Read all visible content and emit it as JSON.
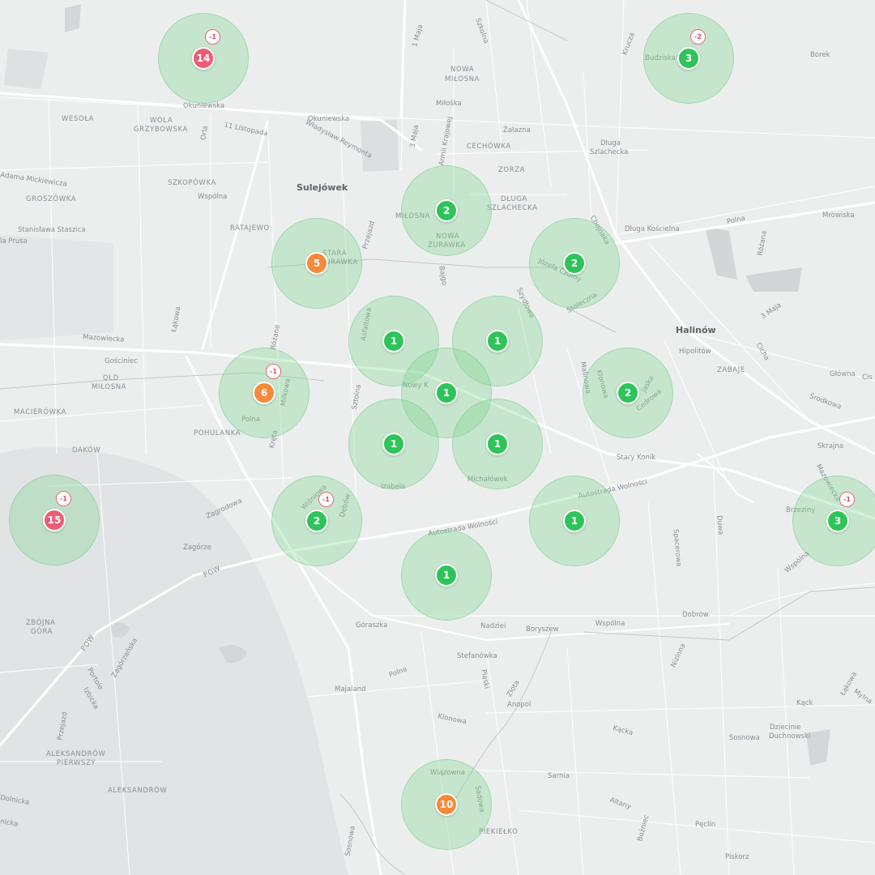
{
  "colors": {
    "green": "#2fc45a",
    "orange": "#f58a3a",
    "red": "#ec5d74",
    "halo": "rgba(120,214,140,0.33)"
  },
  "labels": {
    "okuniewska1": "Okuniewska",
    "okuniewska2": "Okuniewska",
    "wesola": "WESOŁA",
    "wola": "WOLA",
    "grzybowska": "GRZYBOWSKA",
    "orla": "Orla",
    "listopada": "11 Listopada",
    "reymonta": "Władysław Reymonta",
    "maja1": "1 Maja",
    "szkolna": "Szkolna",
    "nowa_milosna": "NOWA",
    "nowa_milosna2": "MIŁOSNA",
    "milosna_street": "Miłośka",
    "maja3": "3 Maja",
    "armii": "Armii Krajowej",
    "cechowka": "CECHÓWKA",
    "zalazna": "Żalazna",
    "dluga1": "Długa",
    "dluga2": "Szlachecka",
    "krucza": "Krucza",
    "borek": "Borek",
    "budziska": "Budziska",
    "mickiewicza": "Adama Mickiewicza",
    "groszowka": "GROSZÓWKA",
    "szkopowka": "SZKOPÓWKA",
    "wspolna1": "Wspólna",
    "sulejowek": "Sulejówek",
    "staszica": "Stanisława Staszica",
    "prusa": "la Prusa",
    "ratajewo": "RATAJEWO",
    "zorza": "ZORZA",
    "dluga_szl1": "DŁUGA",
    "dluga_szl2": "SZLACHECKA",
    "milosna_d": "MIŁOSNA",
    "nowa_zur1": "NOWA",
    "nowa_zur2": "ŻURAWKA",
    "przejazd": "Przejazd",
    "dluga_koscielna": "Długa Kościelna",
    "polna1": "Polna",
    "rozana1": "Różana",
    "mrowiska": "Mrowiska",
    "stara1": "STARA",
    "stara2": "ŻURAWKA",
    "bajgo": "Bajgo",
    "chojnaka": "Chojnaka",
    "jozefa": "Józefa Czumy",
    "stoleczna": "Stołeczna",
    "maja3b": "3 Maja",
    "halinow": "Halinów",
    "mazowiecka": "Mazowiecka",
    "lakowa": "Łąkowa",
    "asfaltowa": "Asfaltowa",
    "szydlowa": "Szydłowa",
    "cicha": "Cicha",
    "hipolitow": "Hipolitów",
    "zabaje": "ZABAJE",
    "glowna": "Główna",
    "cis": "Cis",
    "goscniec": "Gościniec",
    "old_milosna1": "OLD",
    "old_milosna2": "MIŁOSNA",
    "rozane2": "Różane",
    "milkowa": "Miłkowa",
    "nowy_k": "Nowy K",
    "malinowa": "Malinowa",
    "klonowa": "Klonowa",
    "jaska": "jaska",
    "cedrowa": "Cedrowa",
    "srodkowa": "Środkowa",
    "maciorowka": "MACIERÓWKA",
    "polna2": "Polna",
    "pohulanka": "POHULANKA",
    "kreta": "Kręta",
    "sztolna": "Sztolna",
    "skrajna": "Skrajna",
    "stary_konik": "Stary Konik",
    "dakow": "DAKÓW",
    "izabela": "Izabela",
    "michalowek": "Michałówek",
    "autostrada1": "Autostrada Wolności",
    "mazowiecka2": "Mazowiecka",
    "zagrodowa": "Zagrodowa",
    "wisniowa": "Wiśniowa",
    "debow": "Dębów",
    "brzeziny": "Brzeziny",
    "zagorze": "Zagórze",
    "autostrada2": "Autostrada Wolności",
    "duwa": "Duwa",
    "spacerowa": "Spacerowa",
    "wspolna2": "Wspólna",
    "pow1": "POW",
    "zbojna1": "ZBÓJNA",
    "zbojna2": "GÓRA",
    "goraszka": "Góraszka",
    "nadziei": "Nadziei",
    "boryszew": "Boryszew",
    "wspolna3": "Wspólna",
    "dobrow": "Dobrów",
    "pow2": "POW",
    "zagorzanska": "Zagórzańska",
    "stefanowka": "Stefanówka",
    "polna3": "Polna",
    "piaski": "Piaski",
    "portole": "Portole",
    "izbicka": "Izbicka",
    "majaland": "Majaland",
    "zlota": "Złota",
    "anopol": "Anopol",
    "nizinna": "Nizinna",
    "kack": "Kąck",
    "lakowa2": "Łąkowa",
    "mylna": "Mylna",
    "przejazd2": "Przejazd",
    "klonowa2": "Klonowa",
    "kacka": "Kącka",
    "sosnowa1": "Sosnowa",
    "dziecinie1": "Dziecinie",
    "dziecinie2": "Duchnowski",
    "aleks1": "ALEKSANDRÓW",
    "aleks2": "PIERWSZY",
    "aleks3": "ALEKSANDRÓW",
    "sarnia": "Sarnia",
    "altany": "Altany",
    "wiazowna": "Wiązowna",
    "sadowa": "Sadowa",
    "boznicka": "Bożniec",
    "peclin": "Pęclin",
    "piekielko": "PIEKIEŁKO",
    "piskorz": "Piskorz",
    "sosnowa2": "Sosnowa",
    "dolnicka": "Dolnicka",
    "nicka": "nicka"
  },
  "clusters": [
    {
      "count": "14",
      "color": "red",
      "badge": "-1"
    },
    {
      "count": "3",
      "color": "green",
      "badge": "-2"
    },
    {
      "count": "2",
      "color": "green",
      "badge": ""
    },
    {
      "count": "5",
      "color": "orange",
      "badge": ""
    },
    {
      "count": "2",
      "color": "green",
      "badge": ""
    },
    {
      "count": "1",
      "color": "green",
      "badge": ""
    },
    {
      "count": "1",
      "color": "green",
      "badge": ""
    },
    {
      "count": "1",
      "color": "green",
      "badge": ""
    },
    {
      "count": "6",
      "color": "orange",
      "badge": "-1"
    },
    {
      "count": "2",
      "color": "green",
      "badge": ""
    },
    {
      "count": "1",
      "color": "green",
      "badge": ""
    },
    {
      "count": "1",
      "color": "green",
      "badge": ""
    },
    {
      "count": "15",
      "color": "red",
      "badge": "-1"
    },
    {
      "count": "2",
      "color": "green",
      "badge": "-1"
    },
    {
      "count": "1",
      "color": "green",
      "badge": ""
    },
    {
      "count": "3",
      "color": "green",
      "badge": "-1"
    },
    {
      "count": "1",
      "color": "green",
      "badge": ""
    },
    {
      "count": "10",
      "color": "orange",
      "badge": ""
    }
  ]
}
